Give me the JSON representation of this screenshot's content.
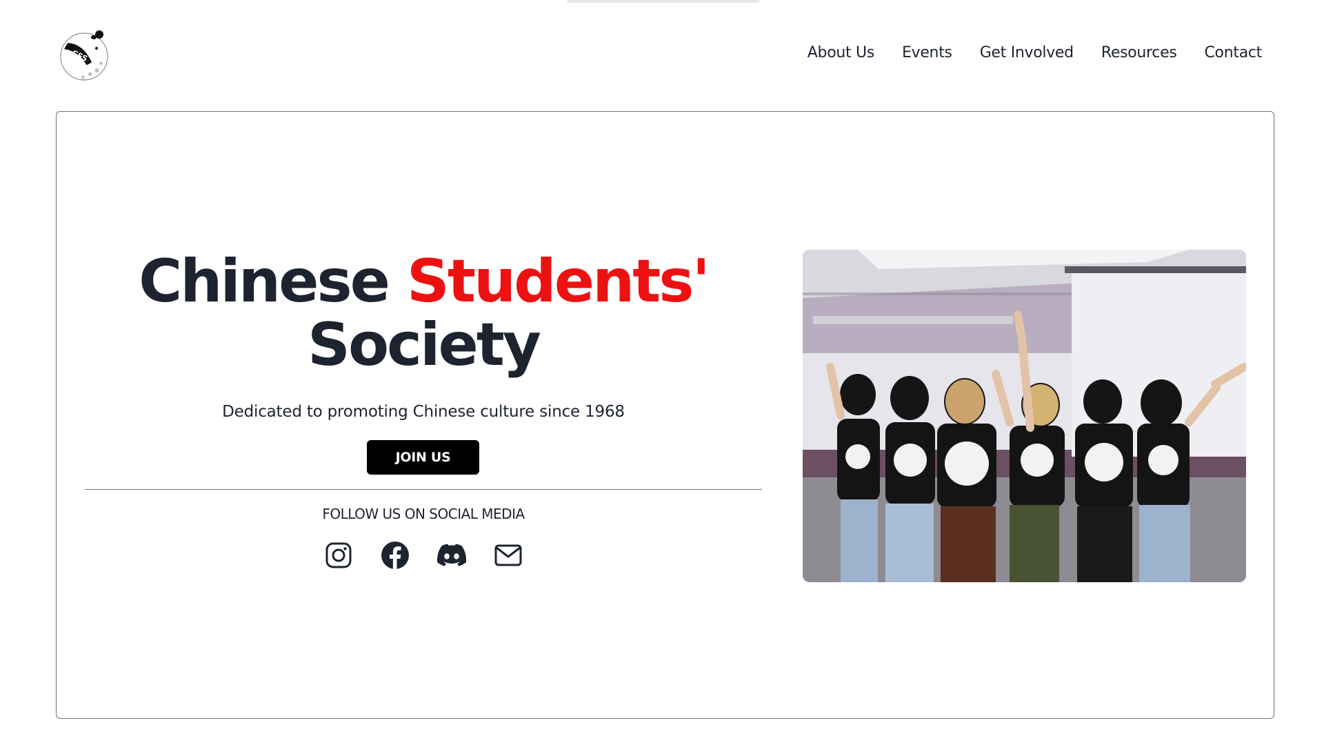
{
  "colors": {
    "accent": "#ee1111",
    "text": "#1e2330",
    "button_bg": "#000000",
    "button_text": "#ffffff",
    "border": "#6f7277"
  },
  "header": {
    "logo_icon": "css-panda-logo",
    "logo_text": "CSS",
    "nav": [
      {
        "label": "About Us"
      },
      {
        "label": "Events"
      },
      {
        "label": "Get Involved"
      },
      {
        "label": "Resources"
      },
      {
        "label": "Contact"
      }
    ]
  },
  "hero": {
    "title_part1": "Chinese ",
    "title_accent": "Students'",
    "title_part2": "Society",
    "tagline": "Dedicated to promoting Chinese culture since 1968",
    "cta_label": "JOIN US",
    "social_heading": "FOLLOW US ON SOCIAL MEDIA",
    "social_icons": [
      "instagram-icon",
      "facebook-icon",
      "discord-icon",
      "email-icon"
    ],
    "photo": "group-photo"
  }
}
